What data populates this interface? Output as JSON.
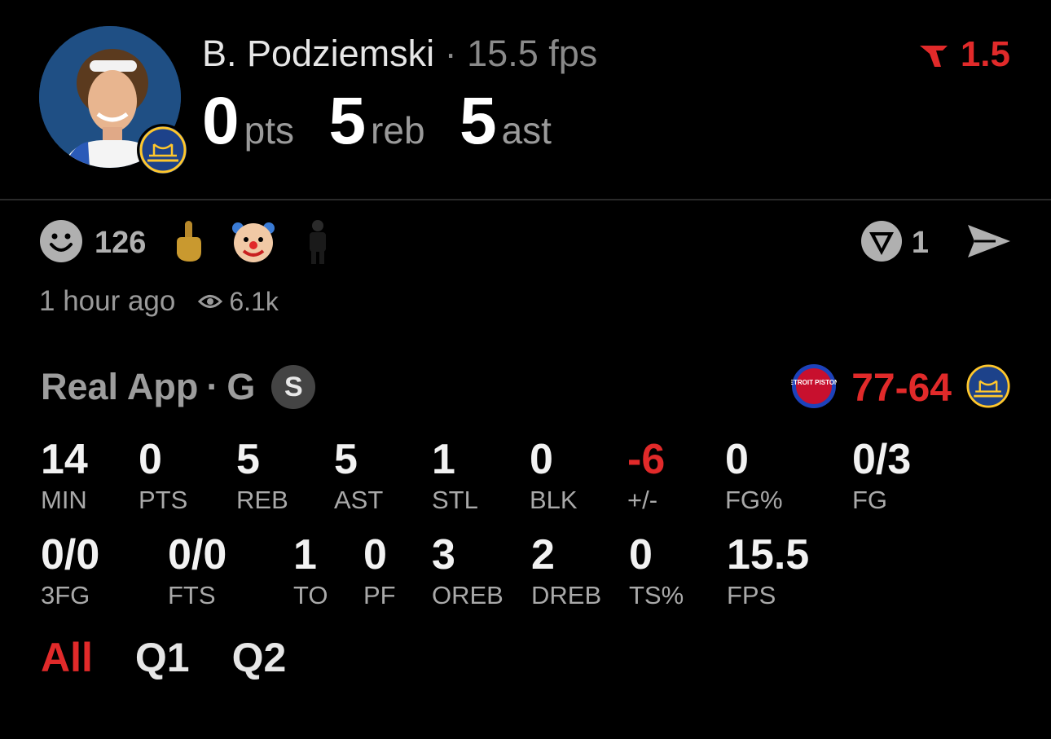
{
  "player": {
    "name": "B. Podziemski",
    "separator": "·",
    "fps_text": "15.5 fps",
    "pts": "0",
    "pts_label": "pts",
    "reb": "5",
    "reb_label": "reb",
    "ast": "5",
    "ast_label": "ast",
    "team_logo_icon": "warriors-logo-icon"
  },
  "boost": {
    "value": "1.5",
    "icon": "boost-arrow-icon",
    "color": "#e12a2a"
  },
  "reactions": {
    "smile_count": "126",
    "items": [
      "middle-finger-icon",
      "clown-face-icon",
      "person-figure-icon"
    ],
    "share_count": "1"
  },
  "meta": {
    "time": "1 hour ago",
    "views": "6.1k"
  },
  "game": {
    "title": "Real App",
    "separator": "·",
    "position": "G",
    "badge": "S",
    "home_logo_icon": "pistons-logo-icon",
    "home_logo_text": "DETROIT PISTONS",
    "home_score": "77",
    "dash": "-",
    "away_score": "64",
    "away_logo_icon": "warriors-logo-icon"
  },
  "stats_row1": [
    {
      "value": "14",
      "label": "MIN"
    },
    {
      "value": "0",
      "label": "PTS"
    },
    {
      "value": "5",
      "label": "REB"
    },
    {
      "value": "5",
      "label": "AST"
    },
    {
      "value": "1",
      "label": "STL"
    },
    {
      "value": "0",
      "label": "BLK"
    },
    {
      "value": "-6",
      "label": "+/-"
    },
    {
      "value": "0",
      "label": "FG%"
    },
    {
      "value": "0/3",
      "label": "FG"
    }
  ],
  "stats_row2": [
    {
      "value": "0/0",
      "label": "3FG"
    },
    {
      "value": "0/0",
      "label": "FTS"
    },
    {
      "value": "1",
      "label": "TO"
    },
    {
      "value": "0",
      "label": "PF"
    },
    {
      "value": "3",
      "label": "OREB"
    },
    {
      "value": "2",
      "label": "DREB"
    },
    {
      "value": "0",
      "label": "TS%"
    },
    {
      "value": "15.5",
      "label": "FPS"
    }
  ],
  "tabs": [
    {
      "label": "All",
      "active": true
    },
    {
      "label": "Q1",
      "active": false
    },
    {
      "label": "Q2",
      "active": false
    }
  ],
  "colors": {
    "accent_red": "#e12a2a",
    "muted": "#9a9a9a",
    "background": "#000000"
  }
}
